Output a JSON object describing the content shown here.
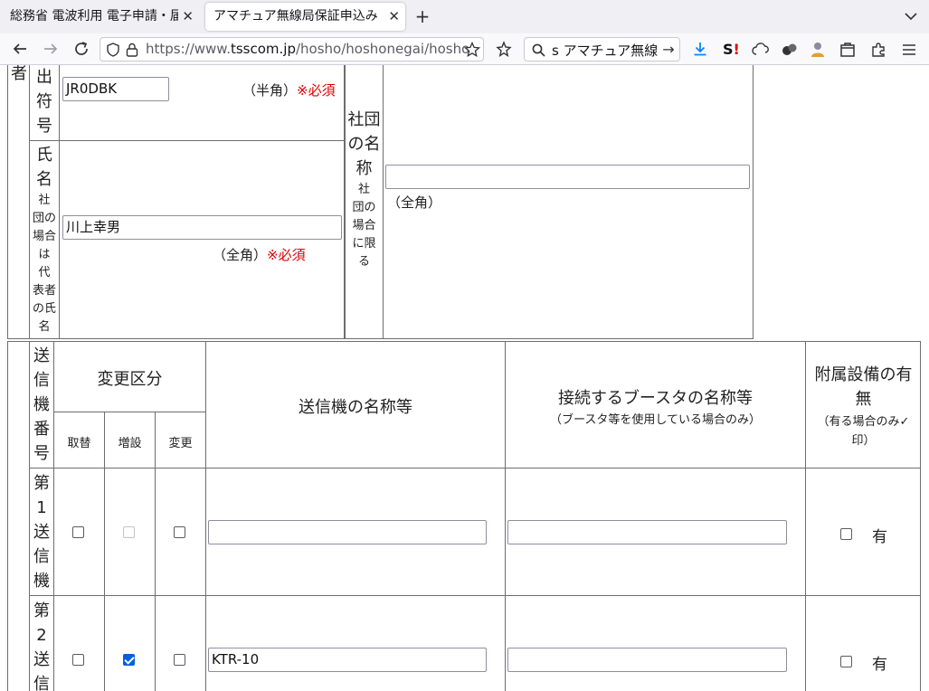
{
  "browser": {
    "tabs": [
      {
        "title": "総務省 電波利用 電子申請・届出システム"
      },
      {
        "title": "アマチュア無線局保証申込み"
      }
    ],
    "url": {
      "prefix": "https://www.",
      "host": "tsscom.jp",
      "path": "/hosho/hoshonegai/hosho"
    },
    "search_text": "s アマチュア無線"
  },
  "form": {
    "applicant_col_char": "者",
    "callsign": {
      "label": [
        "出",
        "符",
        "号"
      ],
      "value": "JR0DBK",
      "note": "（半角）",
      "required": "※必須"
    },
    "name": {
      "label": [
        "氏",
        "名"
      ],
      "sub_label": [
        "社",
        "団の",
        "場合",
        "は",
        "代",
        "表者",
        "の氏",
        "名"
      ],
      "value": "川上幸男",
      "note": "（全角）",
      "required": "※必須"
    },
    "club": {
      "label": [
        "社団",
        "の名",
        "称"
      ],
      "sub_label": [
        "社",
        "団の",
        "場合",
        "に限",
        "る"
      ],
      "value": "",
      "note": "（全角）"
    }
  },
  "transmitters": {
    "headers": {
      "number": [
        "送",
        "信",
        "機",
        "番",
        "号"
      ],
      "change_type": "変更区分",
      "change_types": [
        "取替",
        "増設",
        "変更"
      ],
      "name": "送信機の名称等",
      "booster": "接続するブースタの名称等",
      "booster_note": "（ブースタ等を使用している場合のみ）",
      "attachment_lines": [
        "附属設備の有",
        "無"
      ],
      "attachment_note_lines": [
        "（有る場合のみ✓",
        "印）"
      ]
    },
    "rows": [
      {
        "label": [
          "第",
          "1",
          "送",
          "信",
          "機"
        ],
        "replace": false,
        "add": false,
        "add_disabled": true,
        "modify": false,
        "name": "",
        "booster": "",
        "has_attachment": false,
        "attachment_label": "有"
      },
      {
        "label": [
          "第",
          "2",
          "送",
          "信"
        ],
        "replace": false,
        "add": true,
        "add_disabled": false,
        "modify": false,
        "name": "KTR-10",
        "booster": "",
        "has_attachment": false,
        "attachment_label": "有"
      }
    ]
  }
}
